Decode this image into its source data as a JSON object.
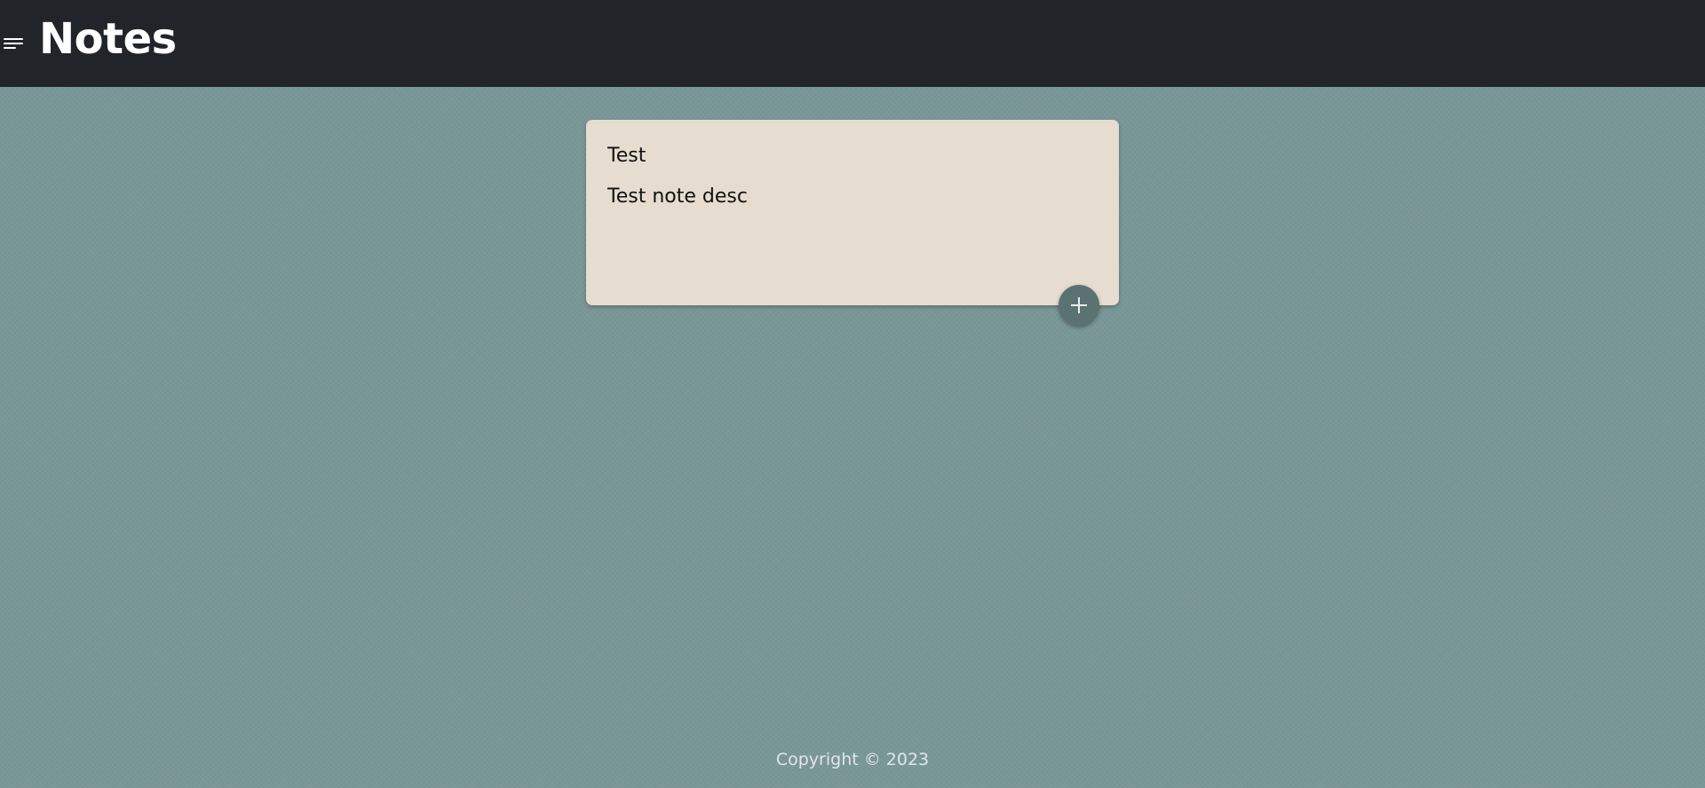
{
  "header": {
    "title": "Notes",
    "menu_icon": "hamburger-menu-icon"
  },
  "notes": [
    {
      "title": "Test",
      "description": "Test note desc"
    }
  ],
  "add_button": {
    "icon": "plus-icon"
  },
  "footer": {
    "text": "Copyright © 2023"
  },
  "colors": {
    "header_bg": "#212429",
    "page_bg": "#7a9797",
    "card_bg": "#e6ddd0",
    "add_button_bg": "#5a7272"
  }
}
